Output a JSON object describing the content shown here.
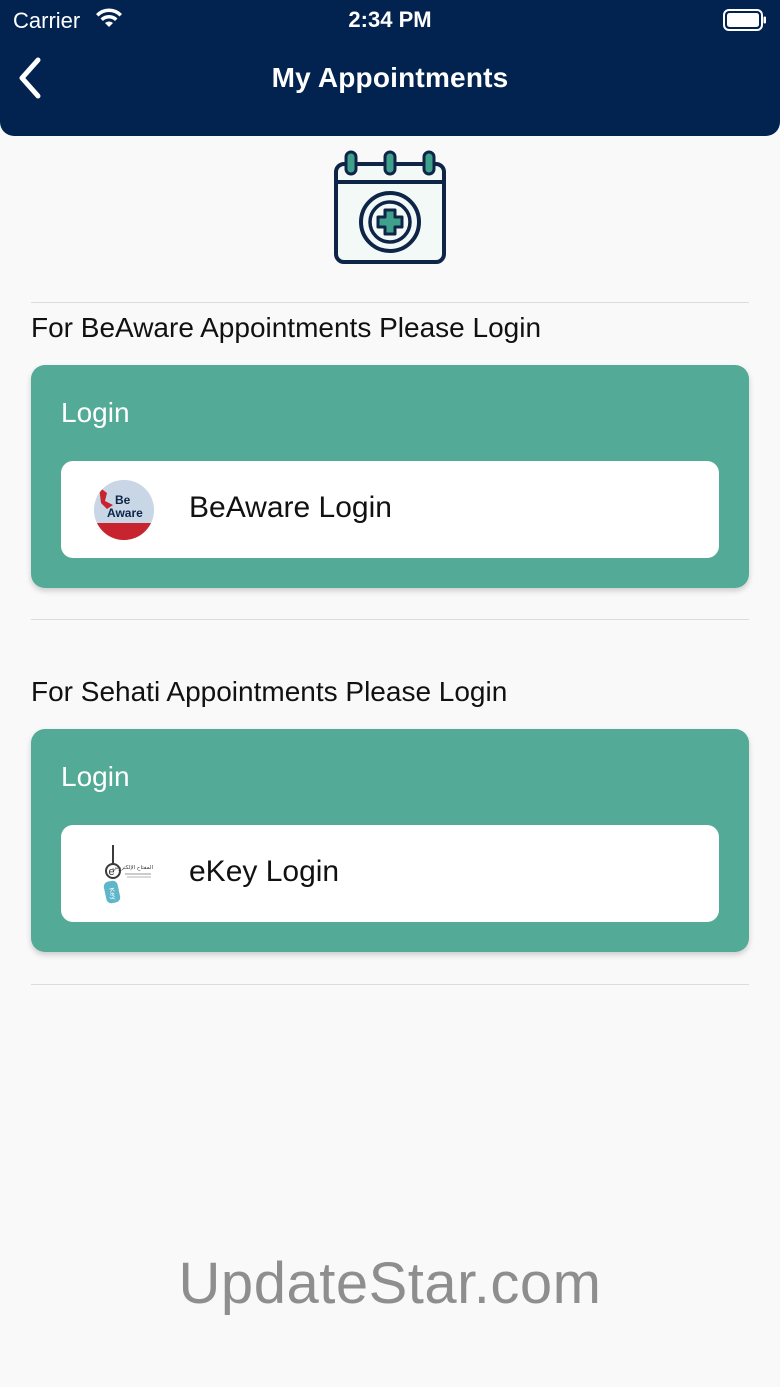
{
  "status_bar": {
    "carrier": "Carrier",
    "time": "2:34 PM"
  },
  "header": {
    "title": "My Appointments",
    "back_icon": "chevron-left-icon"
  },
  "hero_icon": "calendar-medical-icon",
  "sections": [
    {
      "title": "For BeAware Appointments Please Login",
      "card_title": "Login",
      "button_label": "BeAware Login",
      "logo": {
        "name": "beaware-logo",
        "line1": "Be",
        "line2": "Aware"
      }
    },
    {
      "title": "For Sehati Appointments Please Login",
      "card_title": "Login",
      "button_label": "eKey Login",
      "logo": {
        "name": "ekey-logo",
        "letter": "e",
        "arabic": "المفتاح الإلكتروني",
        "tag": "Key"
      }
    }
  ],
  "watermark": "UpdateStar.com",
  "colors": {
    "header_bg": "#02234f",
    "card_bg": "#53aa96",
    "page_bg": "#f9f9fa",
    "icon_teal": "#3fa08c",
    "icon_navy": "#0e2547"
  }
}
